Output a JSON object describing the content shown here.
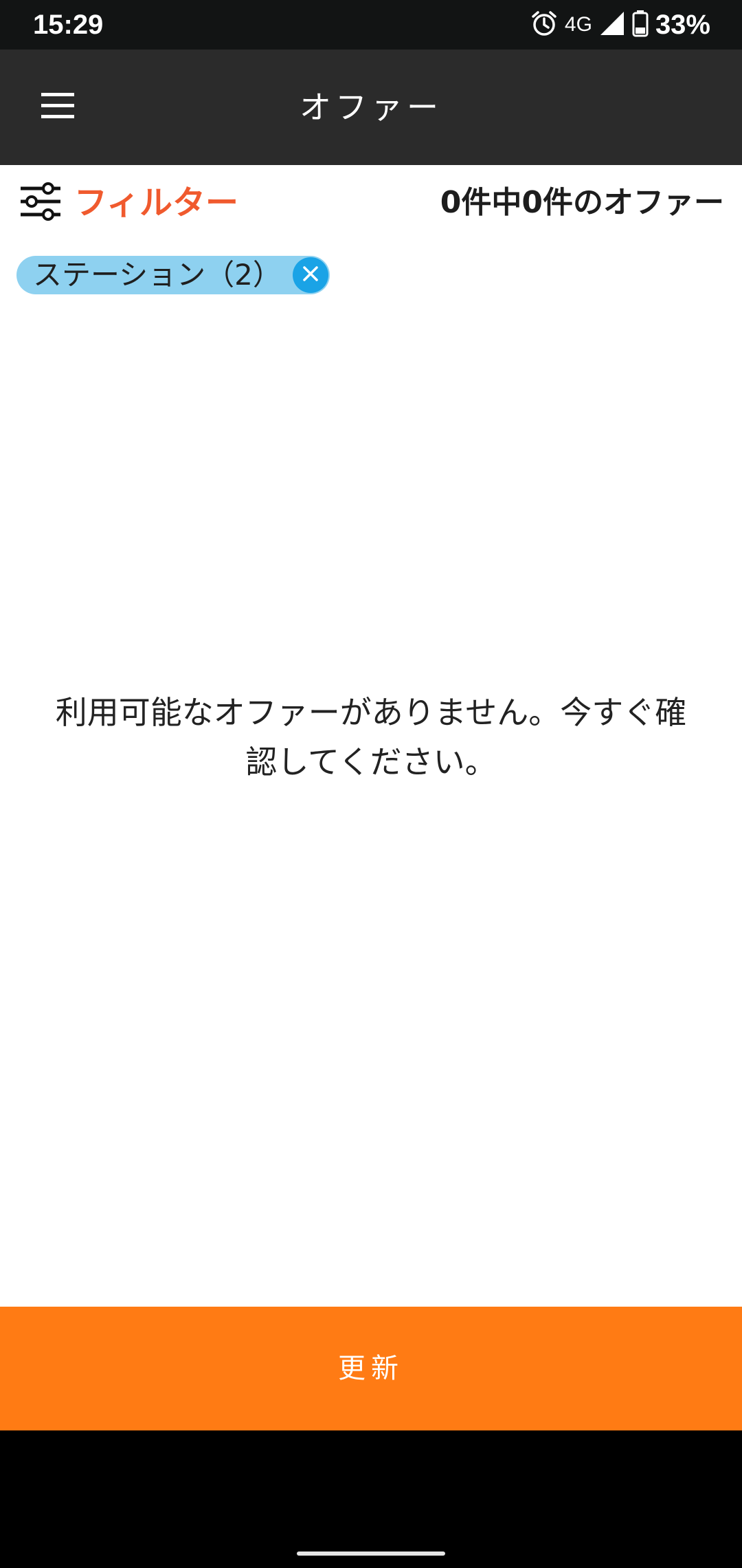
{
  "status_bar": {
    "time": "15:29",
    "network": "4G",
    "battery": "33%",
    "icons": [
      "alarm-icon",
      "signal-icon",
      "battery-icon"
    ]
  },
  "app_bar": {
    "title": "オファー",
    "menu_icon": "hamburger-menu-icon"
  },
  "filter": {
    "label": "フィルター",
    "icon": "sliders-icon",
    "accent_color": "#f05a2e"
  },
  "offer_count": "0件中0件のオファー",
  "chips": [
    {
      "label": "ステーション（2）",
      "close_icon": "close-icon"
    }
  ],
  "empty_message": {
    "line1": "利用可能なオファーがありません。今すぐ確",
    "line2": "認してください。"
  },
  "refresh_button": {
    "label": "更新",
    "color": "#ff7b14"
  },
  "colors": {
    "app_bar": "#2b2b2b",
    "status_bar": "#121414",
    "chip": "#8ed1f0",
    "chip_close": "#1aa3e6"
  }
}
